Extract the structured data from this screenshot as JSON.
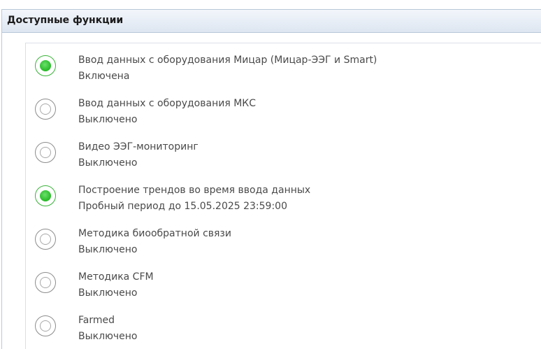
{
  "panel": {
    "title": "Доступные функции"
  },
  "features": [
    {
      "name": "Ввод данных с оборудования Мицар (Мицар-ЭЭГ и Smart)",
      "status": "Включена",
      "enabled": true
    },
    {
      "name": "Ввод данных с оборудования МКС",
      "status": "Выключено",
      "enabled": false
    },
    {
      "name": "Видео ЭЭГ-мониторинг",
      "status": "Выключено",
      "enabled": false
    },
    {
      "name": "Построение трендов во время ввода данных",
      "status": "Пробный период до 15.05.2025 23:59:00",
      "enabled": true
    },
    {
      "name": "Методика биообратной связи",
      "status": "Выключено",
      "enabled": false
    },
    {
      "name": "Методика CFM",
      "status": "Выключено",
      "enabled": false
    },
    {
      "name": "Farmed",
      "status": "Выключено",
      "enabled": false
    }
  ],
  "colors": {
    "enabled_radio": "#2fbf2f",
    "disabled_radio": "#a8a8a8",
    "header_bg": "#dde6f1"
  }
}
